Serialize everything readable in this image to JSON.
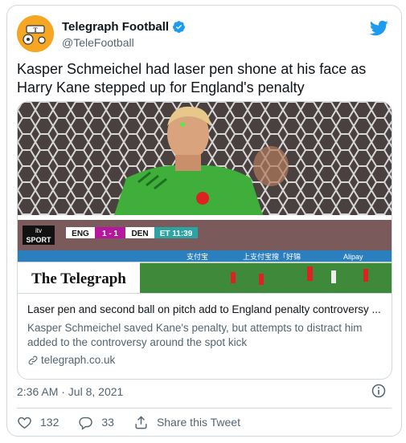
{
  "account": {
    "display_name": "Telegraph Football",
    "handle": "@TeleFootball"
  },
  "tweet": {
    "text": "Kasper Schmeichel had laser pen shone at his face as Harry Kane stepped up for England's penalty"
  },
  "link_card": {
    "title": "Laser pen and second ball on pitch add to England penalty controversy ...",
    "description": "Kasper Schmeichel saved Kane's penalty, but attempts to distract him added to the controversy around the spot kick",
    "domain": "telegraph.co.uk",
    "brand": "The Telegraph",
    "scoreboard": {
      "channel_top": "itv",
      "channel_bottom": "SPORT",
      "home": "ENG",
      "score": "1 - 1",
      "away": "DEN",
      "period": "ET 11:39"
    },
    "ad_text": "上支付宝搜「好锦",
    "ad_brand": "Alipay",
    "ad_brand_left": "支付宝"
  },
  "meta": {
    "timestamp": "2:36 AM · Jul 8, 2021"
  },
  "actions": {
    "like_count": "132",
    "reply_count": "33",
    "share_label": "Share this Tweet"
  },
  "colors": {
    "twitter_blue": "#1d9bf0",
    "like_color": "#536471",
    "avatar_bg": "#f5a623",
    "keeper_green": "#3fae3a",
    "pitch_green": "#3f8a3a"
  },
  "icons": [
    "verified-badge-icon",
    "twitter-bird-icon",
    "link-icon",
    "info-icon",
    "heart-icon",
    "reply-icon",
    "share-icon"
  ]
}
